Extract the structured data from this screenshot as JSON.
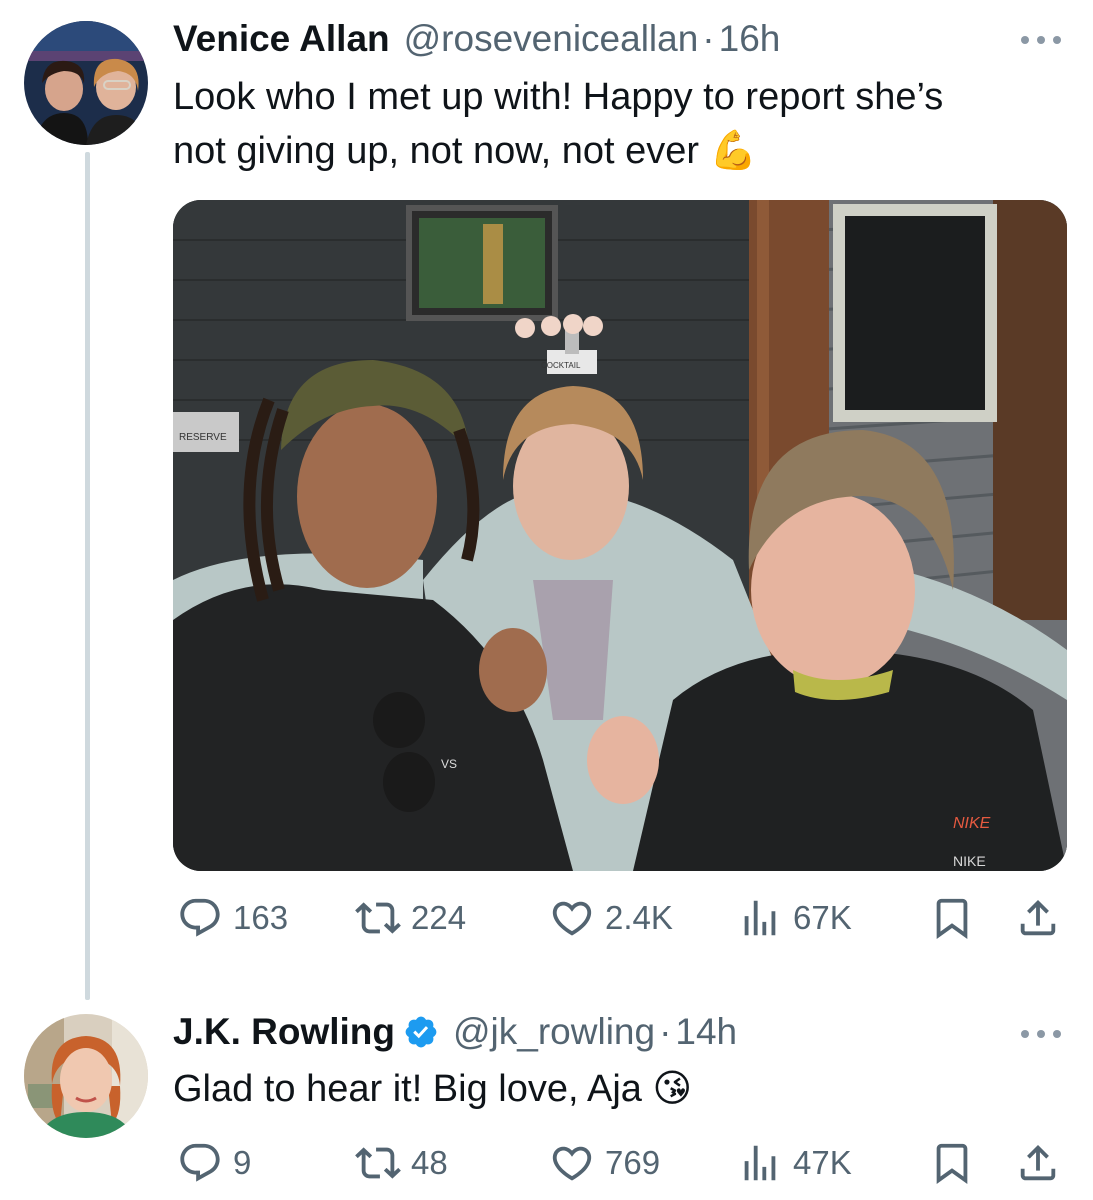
{
  "tweets": [
    {
      "author_name": "Venice Allan",
      "handle": "@roseveniceallan",
      "separator": "·",
      "time": "16h",
      "text_line1": "Look who I met up with! Happy to report she’s",
      "text_line2": "not giving up, not now, not ever",
      "emoji": "💪",
      "photo_sign_text": "RESERVE",
      "photo_tower_label": "COCKTAIL",
      "photo_shirt_brand": "NIKE",
      "photo_hat_brand": "VS",
      "stats": {
        "replies": "163",
        "reposts": "224",
        "likes": "2.4K",
        "views": "67K"
      }
    },
    {
      "author_name": "J.K. Rowling",
      "verified": true,
      "handle": "@jk_rowling",
      "separator": "·",
      "time": "14h",
      "text": "Glad to hear it! Big love, Aja",
      "emoji": "😘",
      "stats": {
        "replies": "9",
        "reposts": "48",
        "likes": "769",
        "views": "47K"
      }
    }
  ],
  "icons": {
    "reply": "reply-icon",
    "repost": "repost-icon",
    "like": "heart-icon",
    "views": "views-icon",
    "bookmark": "bookmark-icon",
    "share": "share-icon",
    "more": "more-icon",
    "verified": "verified-badge-icon"
  },
  "colors": {
    "text": "#0f1419",
    "secondary": "#536471",
    "verified": "#1d9bf0",
    "thread_line": "#cfd9de"
  }
}
